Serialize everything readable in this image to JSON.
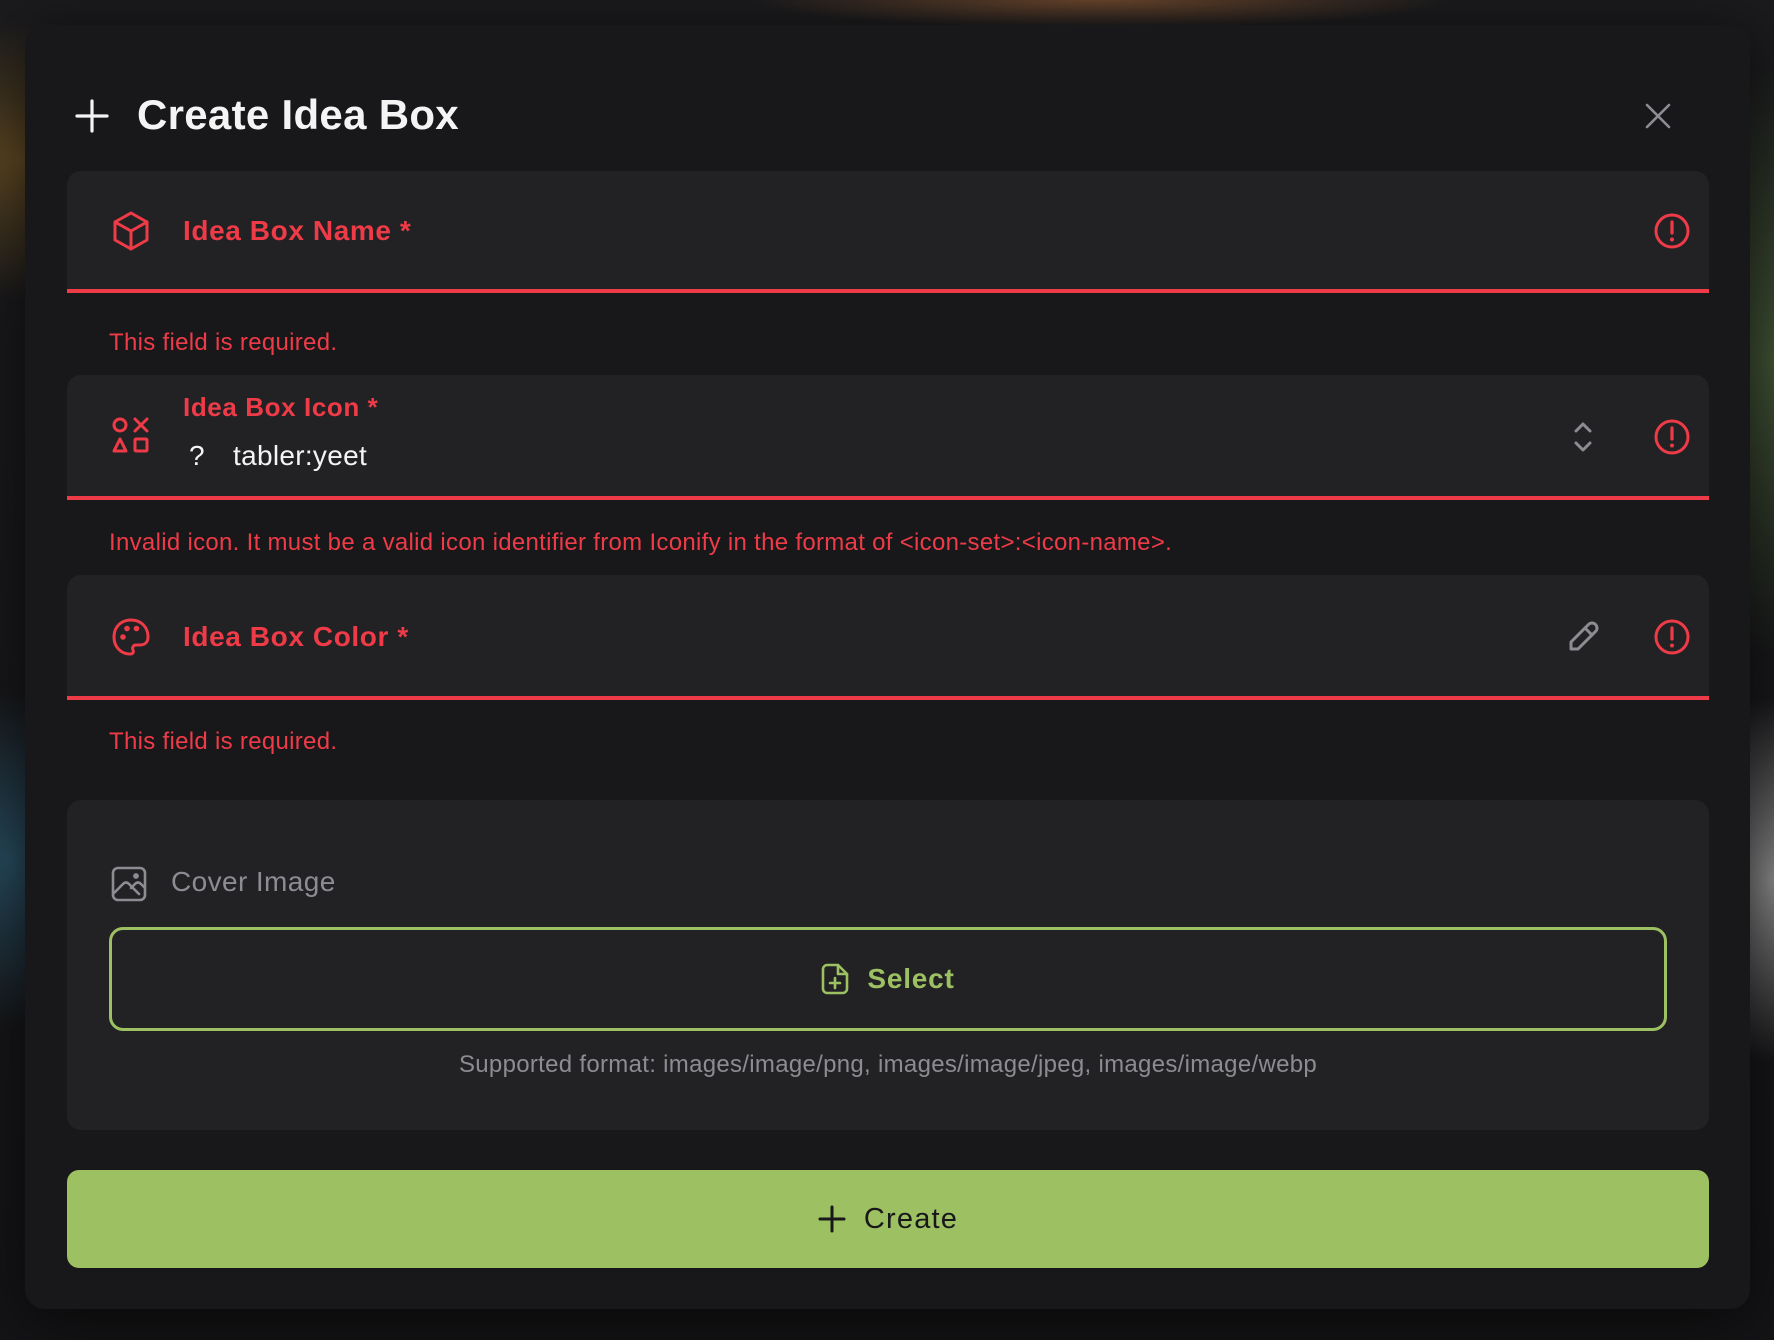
{
  "modal": {
    "title": "Create Idea Box"
  },
  "fields": {
    "name": {
      "label": "Idea Box Name *",
      "error": "This field is required."
    },
    "icon": {
      "label": "Idea Box Icon *",
      "preview_glyph": "?",
      "value": "tabler:yeet",
      "error": "Invalid icon. It must be a valid icon identifier from Iconify in the format of <icon-set>:<icon-name>."
    },
    "color": {
      "label": "Idea Box Color *",
      "error": "This field is required."
    },
    "cover": {
      "label": "Cover Image",
      "select_label": "Select",
      "hint": "Supported format: images/image/png, images/image/jpeg, images/image/webp"
    }
  },
  "create_button": {
    "label": "Create"
  },
  "colors": {
    "error": "#ef3b47",
    "accent": "#9dc062",
    "panel": "#18181b",
    "field": "#222225"
  }
}
